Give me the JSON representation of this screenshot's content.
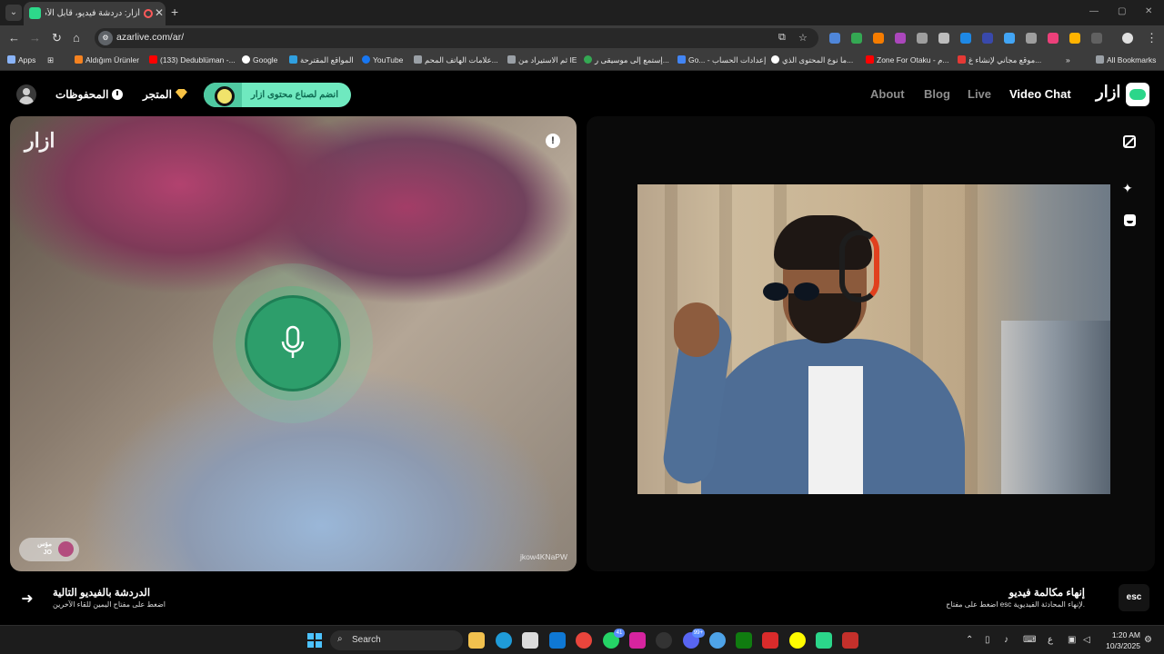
{
  "browser": {
    "tab_title": "أزار: دردشة فيديو، قابل الأصد...",
    "new_tab_label": "+",
    "url": "azarlive.com/ar/",
    "window_controls": [
      "—",
      "▢",
      "✕"
    ]
  },
  "bookmarks": [
    {
      "label": "Apps",
      "color": "#8ab4f8"
    },
    {
      "label": "Aldığım Ürünler",
      "color": "#f58220"
    },
    {
      "label": "(133) Dedublüman -...",
      "color": "#ff0000"
    },
    {
      "label": "Google",
      "color": "#ffffff"
    },
    {
      "label": "المواقع المقترحة",
      "color": "#30a0e0"
    },
    {
      "label": "YouTube",
      "color": "#1877f2"
    },
    {
      "label": "علامات الهاتف المحم...",
      "color": "#9aa0a6"
    },
    {
      "label": "ثم الاستيراد من IE",
      "color": "#9aa0a6"
    },
    {
      "label": "إستمع إلى موسيقى ر...",
      "color": "#34a853"
    },
    {
      "label": "Go... - إعدادات الحساب",
      "color": "#4285f4"
    },
    {
      "label": "ما نوع المحتوى الذي...",
      "color": "#ffffff"
    },
    {
      "label": "Zone For Otaku - م...",
      "color": "#ff0000"
    },
    {
      "label": "موقع مجاني لإنشاء غ...",
      "color": "#e53935"
    },
    {
      "label": "All Bookmarks",
      "color": "#9aa0a6"
    }
  ],
  "header": {
    "saved_label": "المحفوظات",
    "store_label": "المتجر",
    "promo_label": "انضم لصناع محتوى ازار",
    "nav": [
      "About",
      "Blog",
      "Live",
      "Video Chat"
    ],
    "brand": "ازار"
  },
  "left_video": {
    "watermark": "ازار",
    "report_icon": "!",
    "user_name": "مؤس",
    "user_country": "JO",
    "user_id": "jkow4KNaPW"
  },
  "footer": {
    "next_title": "الدردشة بالفيديو التالية",
    "next_hint": "اضغط على مفتاح اليمين للقاء الآخرين",
    "end_title": "إنهاء مكالمة فيديو",
    "end_hint": "اضغط على مفتاح esc لإنهاء المحادثة الفيديوية.",
    "esc_key": "esc"
  },
  "taskbar": {
    "search_label": "Search",
    "whatsapp_badge": "41",
    "discord_badge": "99+",
    "lang": "ع",
    "time": "1:20 AM",
    "date": "10/3/2025"
  },
  "colors": {
    "accent": "#2d9e6b",
    "promo": "#6fe9bf",
    "brand_green": "#2bd68a"
  }
}
